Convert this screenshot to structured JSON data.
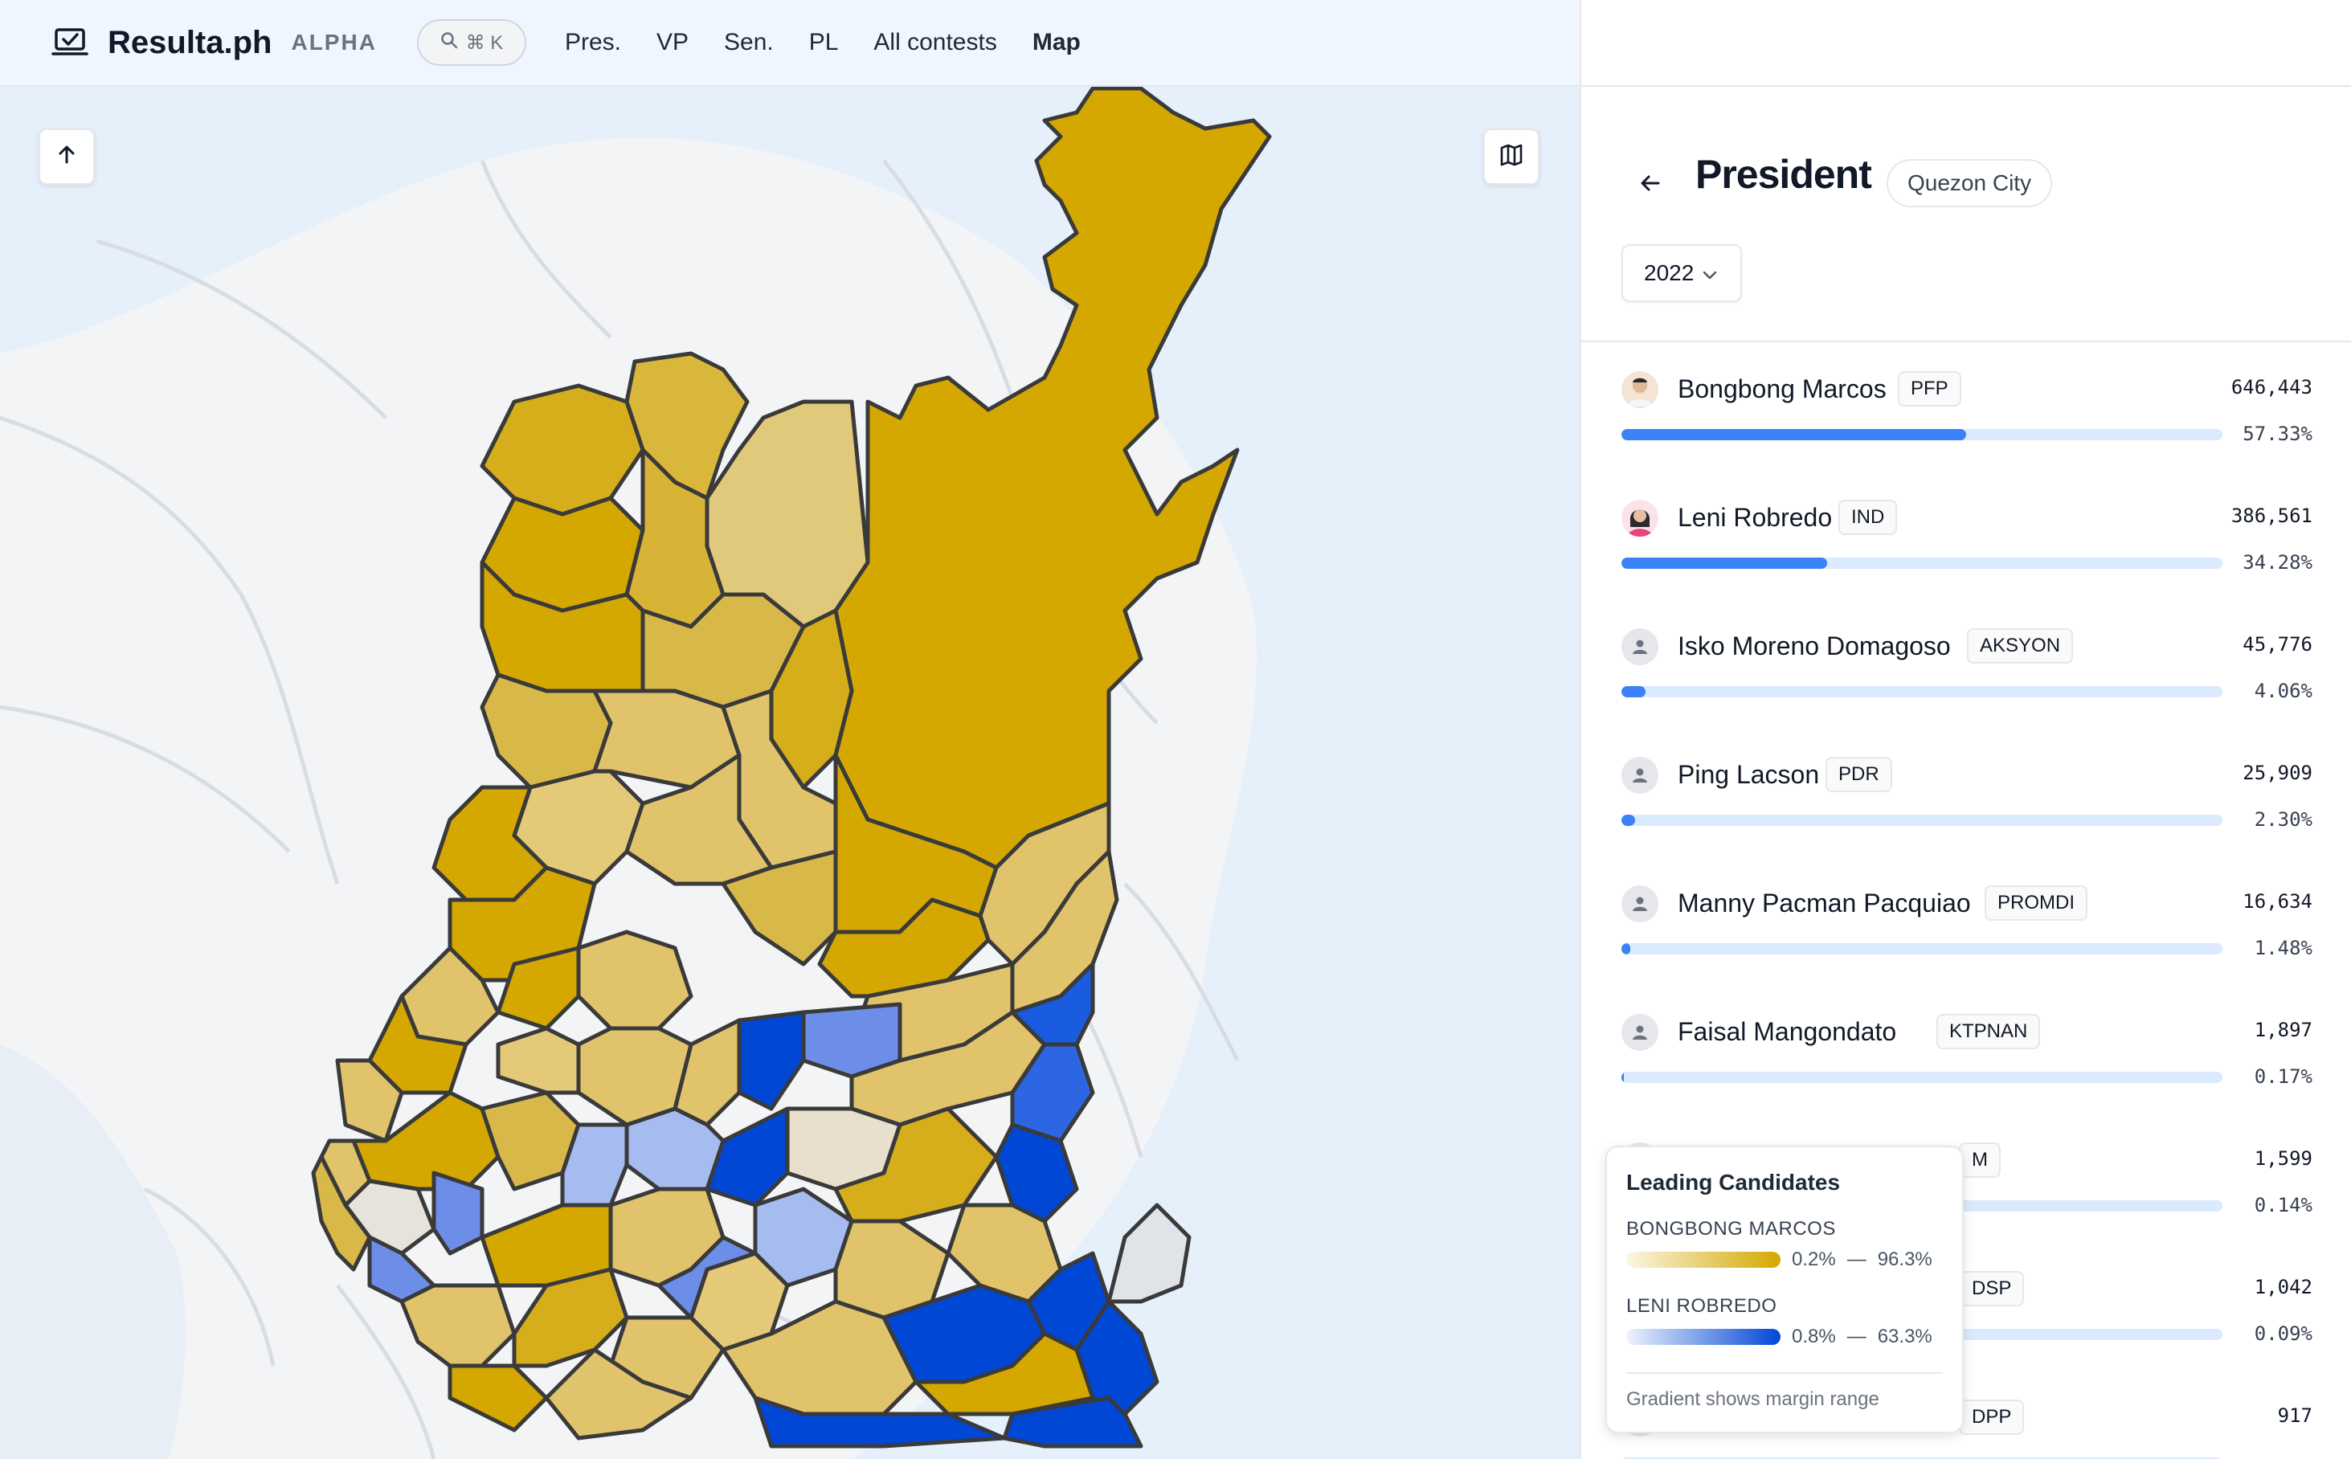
{
  "header": {
    "app_name": "Resulta.ph",
    "tag": "ALPHA",
    "search_shortcut": "⌘ K",
    "nav": [
      {
        "label": "Pres."
      },
      {
        "label": "VP"
      },
      {
        "label": "Sen."
      },
      {
        "label": "PL"
      },
      {
        "label": "All contests"
      },
      {
        "label": "Map",
        "active": true
      }
    ]
  },
  "panel": {
    "title": "President",
    "location": "Quezon City",
    "year": "2022",
    "candidates": [
      {
        "name": "Bongbong Marcos",
        "party": "PFP",
        "votes": "646,443",
        "pct": "57.33%",
        "share": 57.33,
        "avatar": "photo-marcos"
      },
      {
        "name": "Leni Robredo",
        "party": "IND",
        "votes": "386,561",
        "pct": "34.28%",
        "share": 34.28,
        "avatar": "photo-robredo"
      },
      {
        "name": "Isko Moreno Domagoso",
        "party": "AKSYON",
        "votes": "45,776",
        "pct": "4.06%",
        "share": 4.06,
        "avatar": "person-icon"
      },
      {
        "name": "Ping Lacson",
        "party": "PDR",
        "votes": "25,909",
        "pct": "2.30%",
        "share": 2.3,
        "avatar": "person-icon"
      },
      {
        "name": "Manny Pacman Pacquiao",
        "party": "PROMDI",
        "votes": "16,634",
        "pct": "1.48%",
        "share": 1.48,
        "avatar": "person-icon"
      },
      {
        "name": "Faisal Mangondato",
        "party": "KTPNAN",
        "votes": "1,897",
        "pct": "0.17%",
        "share": 0.17,
        "avatar": "person-icon"
      },
      {
        "name": "",
        "party": "M",
        "votes": "1,599",
        "pct": "0.14%",
        "share": 0.14,
        "avatar": "person-icon"
      },
      {
        "name": "",
        "party": "DSP",
        "votes": "1,042",
        "pct": "0.09%",
        "share": 0.09,
        "avatar": "person-icon"
      },
      {
        "name": "",
        "party": "DPP",
        "votes": "917",
        "pct": "",
        "share": 0.08,
        "avatar": "person-icon"
      }
    ]
  },
  "legend": {
    "title": "Leading Candidates",
    "items": [
      {
        "name": "BONGBONG MARCOS",
        "min": "0.2%",
        "max": "96.3%",
        "color": "#d4a800"
      },
      {
        "name": "LENI ROBREDO",
        "min": "0.8%",
        "max": "63.3%",
        "color": "#1d4ed8"
      }
    ],
    "dash": "—",
    "note": "Gradient shows margin range"
  },
  "colors": {
    "marcos": "#d4a800",
    "robredo": "#0047d6",
    "bar": "#3b82f6"
  }
}
